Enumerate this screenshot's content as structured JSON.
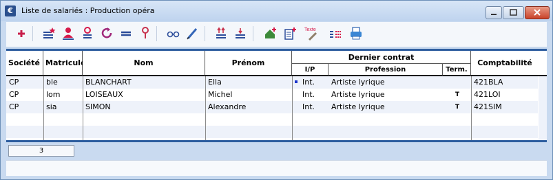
{
  "window": {
    "title": "Liste de salariés : Production opéra",
    "app_icon_letter": "€"
  },
  "toolbar": {
    "icons": [
      "add-icon",
      "new-star-list-icon",
      "user-icon",
      "search-user-icon",
      "refresh-icon",
      "lines-icon",
      "pin-icon",
      "glasses-icon",
      "pen-icon",
      "sort-up-icon",
      "sort-down-icon",
      "home-add-icon",
      "document-add-icon",
      "text-brush-icon",
      "chart-icon",
      "printer-icon"
    ],
    "texte_label": "Texte"
  },
  "table": {
    "headers": {
      "societe": "Société",
      "matricule": "Matricule",
      "nom": "Nom",
      "prenom": "Prénom",
      "dernier_contrat": "Dernier contrat",
      "ip": "I/P",
      "profession": "Profession",
      "term": "Term.",
      "comptabilite": "Comptabilité"
    },
    "rows": [
      {
        "societe": "CP",
        "matricule": "ble",
        "nom": "BLANCHART",
        "prenom": "Ella",
        "ip": "Int.",
        "profession": "Artiste lyrique",
        "term": "",
        "comptabilite": "421BLA"
      },
      {
        "societe": "CP",
        "matricule": "lom",
        "nom": "LOISEAUX",
        "prenom": "Michel",
        "ip": "Int.",
        "profession": "Artiste lyrique",
        "term": "T",
        "comptabilite": "421LOI"
      },
      {
        "societe": "CP",
        "matricule": "sia",
        "nom": "SIMON",
        "prenom": "Alexandre",
        "ip": "Int.",
        "profession": "Artiste lyrique",
        "term": "T",
        "comptabilite": "421SIM"
      }
    ]
  },
  "status": {
    "count": "3"
  },
  "colors": {
    "accent": "#2d5d9f",
    "title_bg": "#c9daf0",
    "close": "#c9432a"
  }
}
